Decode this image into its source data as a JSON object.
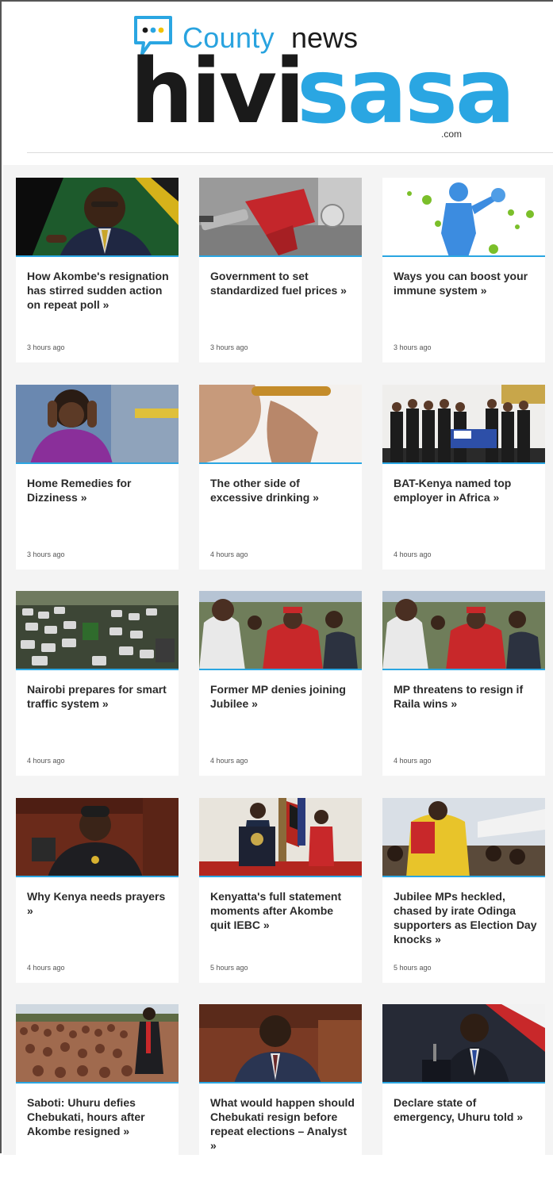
{
  "brand": {
    "tagline_part1": "County",
    "tagline_part2": "news",
    "name_part1": "hivi",
    "name_part2": "sasa",
    "domain": ".com",
    "colors": {
      "blue": "#2aa6e2",
      "dark": "#1a1a1a",
      "accent_yellow": "#f2c200"
    }
  },
  "articles": [
    {
      "title": "How Akombe's resignation has stirred sudden action on repeat poll »",
      "time": "3 hours ago",
      "image": "man-speaking-photo"
    },
    {
      "title": "Government to set standardized fuel prices »",
      "time": "3 hours ago",
      "image": "fuel-nozzle-photo"
    },
    {
      "title": "Ways you can boost your immune system »",
      "time": "3 hours ago",
      "image": "immune-figure-photo"
    },
    {
      "title": "Home Remedies for Dizziness »",
      "time": "3 hours ago",
      "image": "woman-headache-photo"
    },
    {
      "title": "The other side of excessive drinking »",
      "time": "4 hours ago",
      "image": "man-drinking-photo"
    },
    {
      "title": "BAT-Kenya named top employer in Africa »",
      "time": "4 hours ago",
      "image": "award-group-photo"
    },
    {
      "title": "Nairobi prepares for smart traffic system »",
      "time": "4 hours ago",
      "image": "traffic-jam-photo"
    },
    {
      "title": "Former MP denies joining Jubilee »",
      "time": "4 hours ago",
      "image": "crowd-red-shirts-photo"
    },
    {
      "title": "MP threatens to resign if Raila wins »",
      "time": "4 hours ago",
      "image": "crowd-red-shirts-photo"
    },
    {
      "title": "Why Kenya needs prayers »",
      "time": "4 hours ago",
      "image": "woman-parliament-photo"
    },
    {
      "title": "Kenyatta's full statement moments after Akombe quit IEBC »",
      "time": "5 hours ago",
      "image": "podium-statement-photo"
    },
    {
      "title": "Jubilee MPs heckled, chased by irate Odinga supporters as Election Day knocks »",
      "time": "5 hours ago",
      "image": "rally-yellow-photo"
    },
    {
      "title": "Saboti: Uhuru defies Chebukati, hours after Akombe resigned »",
      "time": "",
      "image": "crowd-rally-photo"
    },
    {
      "title": "What would happen should Chebukati resign before repeat elections – Analyst »",
      "time": "",
      "image": "man-in-office-photo"
    },
    {
      "title": "Declare state of emergency, Uhuru told »",
      "time": "",
      "image": "president-podium-photo"
    }
  ]
}
